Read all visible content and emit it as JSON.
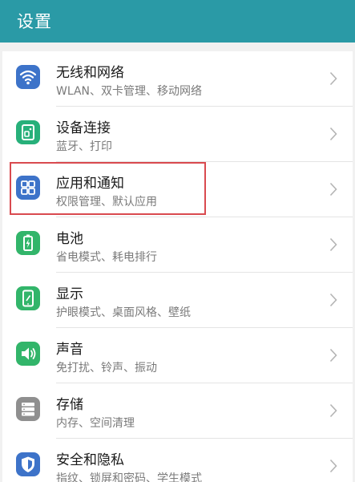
{
  "header": {
    "title": "设置",
    "color": "#2a9aa6"
  },
  "settings": {
    "items": [
      {
        "label": "无线和网络",
        "sub": "WLAN、双卡管理、移动网络",
        "icon": "wifi-icon",
        "icon_color": "#3d73c9"
      },
      {
        "label": "设备连接",
        "sub": "蓝牙、打印",
        "icon": "device-connection-icon",
        "icon_color": "#27b07a"
      },
      {
        "label": "应用和通知",
        "sub": "权限管理、默认应用",
        "icon": "apps-grid-icon",
        "icon_color": "#3d73c9"
      },
      {
        "label": "电池",
        "sub": "省电模式、耗电排行",
        "icon": "battery-icon",
        "icon_color": "#32b56a"
      },
      {
        "label": "显示",
        "sub": "护眼模式、桌面风格、壁纸",
        "icon": "display-icon",
        "icon_color": "#32b56a"
      },
      {
        "label": "声音",
        "sub": "免打扰、铃声、振动",
        "icon": "speaker-icon",
        "icon_color": "#32b56a"
      },
      {
        "label": "存储",
        "sub": "内存、空间清理",
        "icon": "storage-icon",
        "icon_color": "#8f8f8f"
      },
      {
        "label": "安全和隐私",
        "sub": "指纹、锁屏和密码、学生模式",
        "icon": "shield-icon",
        "icon_color": "#3d73c9"
      }
    ]
  },
  "highlight": {
    "target": "应用和通知",
    "color": "#d94a4f"
  }
}
